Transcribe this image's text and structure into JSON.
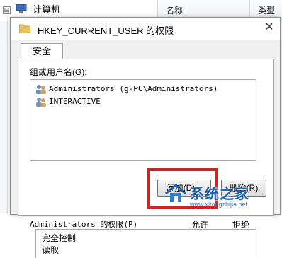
{
  "background_window": {
    "tree_expander": "⊟",
    "tree_item": "计算机",
    "columns": [
      "名称",
      "类型"
    ]
  },
  "dialog": {
    "title": "HKEY_CURRENT_USER 的权限",
    "close_glyph": "✕",
    "tabs": [
      "安全"
    ],
    "group_label": "组或用户名(G):",
    "users": [
      {
        "name": "Administrators (g-PC\\Administrators)",
        "icon": "users-group-icon"
      },
      {
        "name": "INTERACTIVE",
        "icon": "users-group-icon"
      }
    ],
    "buttons": {
      "add": "添加(D)...",
      "remove": "删除(R)"
    },
    "permissions_label": "Administrators 的权限(P)",
    "permission_columns": [
      "允许",
      "拒绝"
    ],
    "permissions": [
      "完全控制",
      "读取"
    ]
  },
  "highlight_color": "#d42020",
  "watermark": {
    "text": "系统之家",
    "url": "www.xitongzhijia.net"
  }
}
